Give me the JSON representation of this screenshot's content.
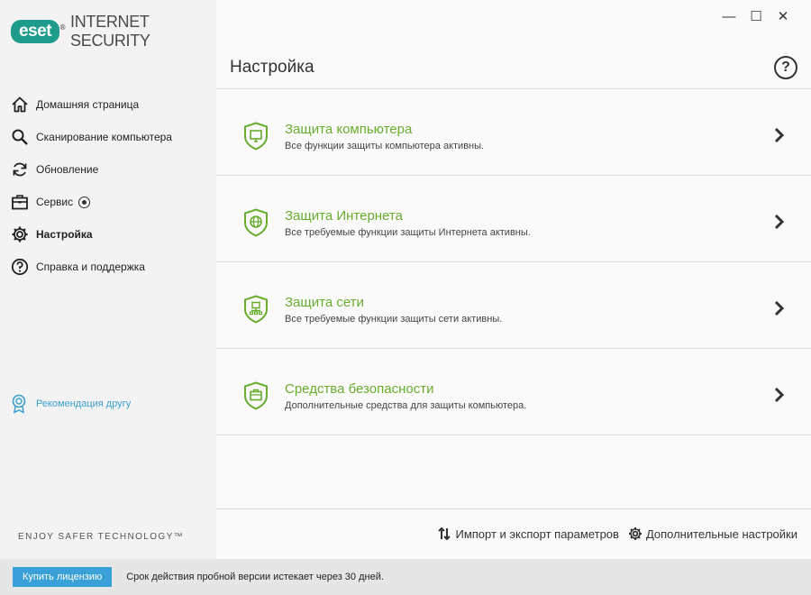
{
  "brand": {
    "logo": "eset",
    "reg": "®",
    "product": "INTERNET SECURITY",
    "accent": "#1d9c8c"
  },
  "window_controls": {
    "minimize": "—",
    "maximize": "☐",
    "close": "✕"
  },
  "sidebar": {
    "items": [
      {
        "label": "Домашняя страница",
        "icon": "home-icon"
      },
      {
        "label": "Сканирование компьютера",
        "icon": "search-icon"
      },
      {
        "label": "Обновление",
        "icon": "refresh-icon"
      },
      {
        "label": "Сервис",
        "icon": "toolbox-icon"
      },
      {
        "label": "Настройка",
        "icon": "gear-icon",
        "active": true
      },
      {
        "label": "Справка и поддержка",
        "icon": "help-icon"
      }
    ],
    "refer": {
      "label": "Рекомендация другу",
      "icon": "award-icon",
      "color": "#3aa0cc"
    },
    "tagline": "ENJOY SAFER TECHNOLOGY™"
  },
  "main": {
    "title": "Настройка",
    "help_label": "?",
    "cards": [
      {
        "title": "Защита компьютера",
        "desc": "Все функции защиты компьютера активны.",
        "icon": "shield-monitor-icon"
      },
      {
        "title": "Защита Интернета",
        "desc": "Все требуемые функции защиты Интернета активны.",
        "icon": "shield-globe-icon"
      },
      {
        "title": "Защита сети",
        "desc": "Все требуемые функции защиты сети активны.",
        "icon": "shield-network-icon"
      },
      {
        "title": "Средства безопасности",
        "desc": "Дополнительные средства для защиты компьютера.",
        "icon": "shield-briefcase-icon"
      }
    ],
    "title_color": "#6aad2e",
    "footer": {
      "import_export": "Импорт и экспорт параметров",
      "advanced": "Дополнительные настройки"
    }
  },
  "statusbar": {
    "buy_label": "Купить лицензию",
    "trial_text": "Срок действия пробной версии истекает через 30 дней."
  }
}
